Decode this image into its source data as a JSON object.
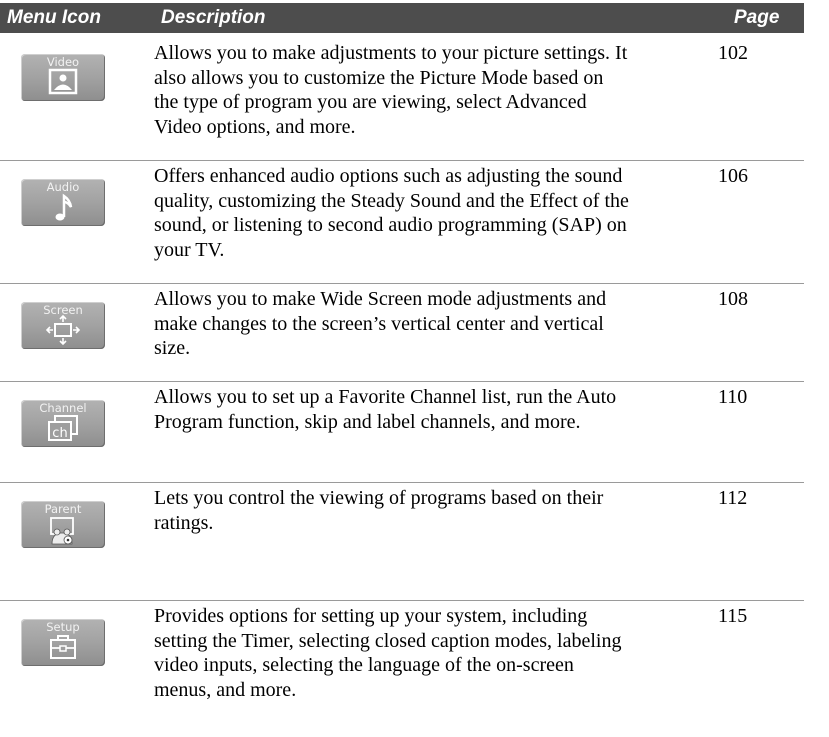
{
  "header": {
    "icon": "Menu Icon",
    "description": "Description",
    "page": "Page"
  },
  "rows": [
    {
      "icon_label": "Video",
      "icon": "video-picture-icon",
      "lines": [
        "Allows you to make adjustments to your picture settings. It",
        "also allows you to customize the Picture Mode based on",
        "the type of program you are viewing, select Advanced",
        "Video options, and more."
      ],
      "page": "102"
    },
    {
      "icon_label": "Audio",
      "icon": "music-note-icon",
      "lines": [
        "Offers enhanced audio options such as adjusting the sound",
        "quality, customizing the Steady Sound and the Effect of the",
        "sound, or listening to second audio programming (SAP) on",
        "your TV."
      ],
      "page": "106"
    },
    {
      "icon_label": "Screen",
      "icon": "screen-resize-icon",
      "lines": [
        "Allows you to make Wide Screen mode adjustments and",
        "make changes to the screen’s vertical center and vertical",
        "size."
      ],
      "page": "108"
    },
    {
      "icon_label": "Channel",
      "icon": "channel-ch-icon",
      "lines": [
        "Allows you to set up a Favorite Channel list, run the Auto",
        "Program function, skip and label channels, and more."
      ],
      "page": "110"
    },
    {
      "icon_label": "Parent",
      "icon": "parent-bear-icon",
      "lines": [
        "Lets you control the viewing of programs based on their",
        "ratings."
      ],
      "page": "112"
    },
    {
      "icon_label": "Setup",
      "icon": "setup-toolbox-icon",
      "lines": [
        "Provides options for setting up your system, including",
        "setting the Timer, selecting closed caption modes, labeling",
        "video inputs, selecting the language of the on-screen",
        "menus, and more."
      ],
      "page": "115"
    }
  ]
}
